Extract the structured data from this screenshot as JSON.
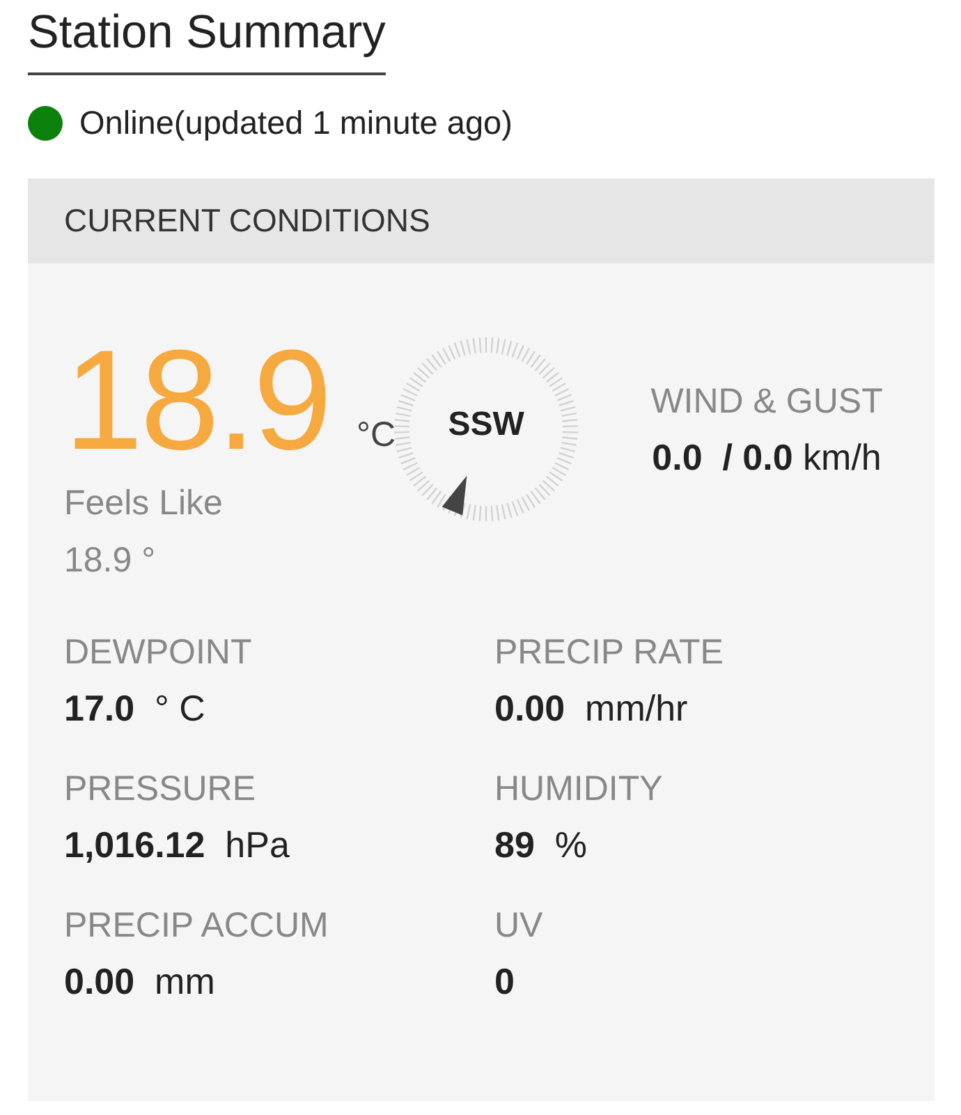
{
  "page": {
    "title": "Station Summary"
  },
  "status": {
    "color": "#0b800b",
    "text": "Online(updated 1 minute ago)"
  },
  "conditions": {
    "title": "CURRENT CONDITIONS",
    "temperature": {
      "value": "18.9",
      "unit": "°C"
    },
    "feels_like": {
      "label": "Feels Like",
      "value": "18.9 °"
    },
    "wind": {
      "direction": "SSW",
      "label": "WIND & GUST",
      "reading": "**0.0  / 0.0** km/h"
    },
    "metrics": [
      {
        "label": "DEWPOINT",
        "value": "**17.0**  ° C"
      },
      {
        "label": "PRECIP RATE",
        "value": "**0.00**  mm/hr"
      },
      {
        "label": "PRESSURE",
        "value": "**1,016.12**  hPa"
      },
      {
        "label": "HUMIDITY",
        "value": "**89**  %"
      },
      {
        "label": "PRECIP ACCUM",
        "value": "**0.00**  mm"
      },
      {
        "label": "UV",
        "value": "**0**"
      }
    ]
  }
}
